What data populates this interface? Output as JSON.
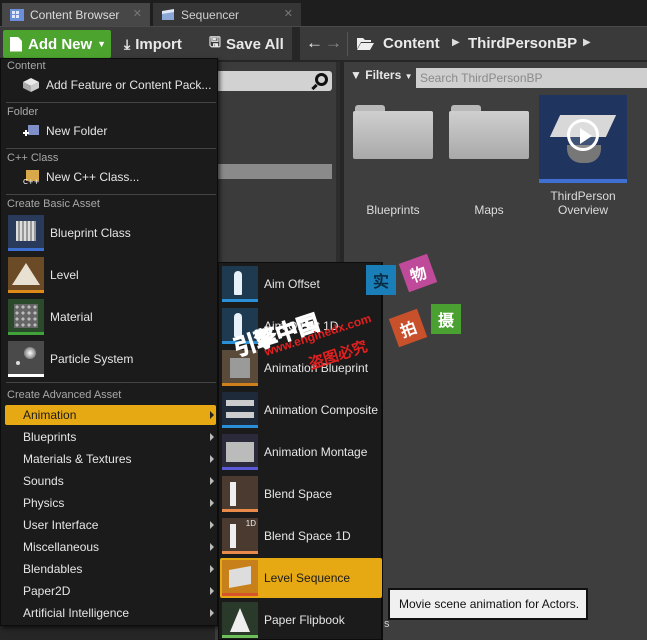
{
  "tabs": [
    {
      "label": "Content Browser",
      "active": true,
      "icon": "content-browser-icon"
    },
    {
      "label": "Sequencer",
      "active": false,
      "icon": "sequencer-icon"
    }
  ],
  "toolbar": {
    "add_new_label": "Add New",
    "import_label": "Import",
    "save_all_label": "Save All"
  },
  "breadcrumb": [
    "Content",
    "ThirdPersonBP"
  ],
  "asset_view": {
    "filters_label": "Filters",
    "search_placeholder": "Search ThirdPersonBP",
    "items": [
      {
        "label": "Blueprints",
        "type": "folder"
      },
      {
        "label": "Maps",
        "type": "folder"
      },
      {
        "label_line1": "ThirdPerson",
        "label_line2": "Overview",
        "type": "tutorial"
      }
    ]
  },
  "menu": {
    "sections": {
      "content": "Content",
      "folder": "Folder",
      "cpp": "C++ Class",
      "basic": "Create Basic Asset",
      "advanced": "Create Advanced Asset"
    },
    "add_feature": "Add Feature or Content Pack...",
    "new_folder": "New Folder",
    "new_cpp": "New C++ Class...",
    "basic_assets": [
      {
        "label": "Blueprint Class",
        "color": "#3d6fd1"
      },
      {
        "label": "Level",
        "color": "#e08a1a"
      },
      {
        "label": "Material",
        "color": "#3fa33a"
      },
      {
        "label": "Particle System",
        "color": "#ffffff"
      }
    ],
    "advanced_categories": [
      {
        "label": "Animation",
        "selected": true
      },
      {
        "label": "Blueprints"
      },
      {
        "label": "Materials & Textures"
      },
      {
        "label": "Sounds"
      },
      {
        "label": "Physics"
      },
      {
        "label": "User Interface"
      },
      {
        "label": "Miscellaneous"
      },
      {
        "label": "Blendables"
      },
      {
        "label": "Paper2D"
      },
      {
        "label": "Artificial Intelligence"
      }
    ]
  },
  "submenu": {
    "items": [
      {
        "label": "Aim Offset",
        "color": "#2a8fd6"
      },
      {
        "label": "Aim Offset 1D",
        "color": "#2a8fd6"
      },
      {
        "label": "Animation Blueprint",
        "color": "#d0801a"
      },
      {
        "label": "Animation Composite",
        "color": "#2a8fd6"
      },
      {
        "label": "Animation Montage",
        "color": "#5a5ad8"
      },
      {
        "label": "Blend Space",
        "color": "#e88a4a"
      },
      {
        "label": "Blend Space 1D",
        "color": "#e88a4a"
      },
      {
        "label": "Level Sequence",
        "color": "#d8542a",
        "selected": true
      },
      {
        "label": "Paper Flipbook",
        "color": "#6dbf5a"
      }
    ]
  },
  "tooltip": "Movie scene animation for Actors.",
  "watermark": {
    "stamps": [
      "实",
      "物",
      "拍",
      "摄"
    ],
    "line1": "引擎中国",
    "line2": "www.enginedx.com",
    "line3": "盗图必究"
  }
}
